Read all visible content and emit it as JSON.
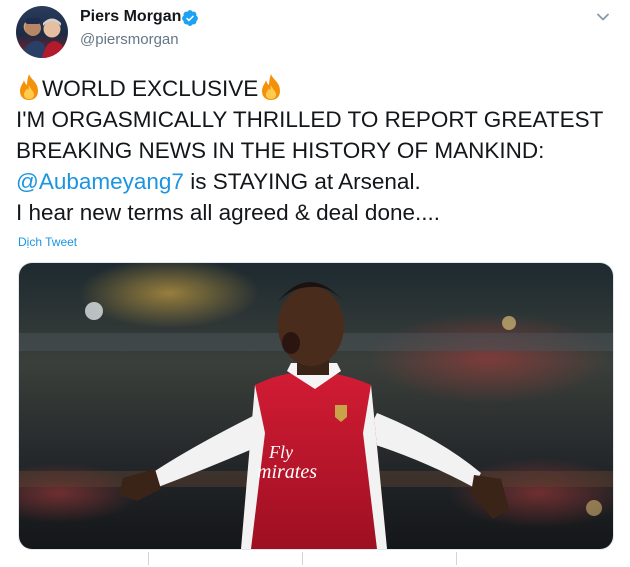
{
  "tweet": {
    "author": {
      "display_name": "Piers Morgan",
      "handle": "@piersmorgan",
      "verified": true
    },
    "text": {
      "line1_text": "WORLD EXCLUSIVE",
      "line2": "I'M ORGASMICALLY THRILLED TO REPORT GREATEST",
      "line3": "BREAKING NEWS IN THE HISTORY OF MANKIND:",
      "mention": "@Aubameyang7",
      "line4_rest": " is STAYING at Arsenal.",
      "line5": "I hear new terms all agreed & deal done...."
    },
    "translate_label": "Dịch Tweet",
    "media": {
      "jersey_sponsor_line1": "Fly",
      "jersey_sponsor_line2": "mirates"
    },
    "icons": [
      "verified-icon",
      "chevron-down-icon",
      "fire-icon"
    ],
    "colors": {
      "link": "#1b95e0",
      "verified": "#1da1f2",
      "jersey_red": "#c8102e"
    }
  }
}
